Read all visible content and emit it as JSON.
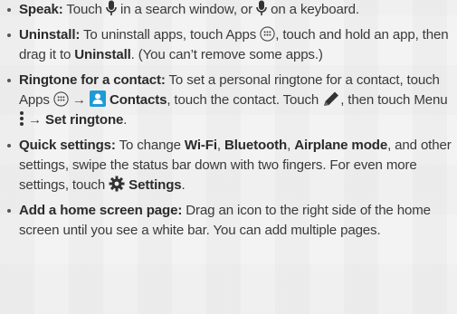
{
  "tips": [
    {
      "title": "Speak:",
      "text_1": " Touch ",
      "text_2": " in a search window, or ",
      "text_3": " on a keyboard."
    },
    {
      "title": "Uninstall:",
      "text_1": " To uninstall apps, touch Apps ",
      "text_2": ", touch and hold an app, then drag it to ",
      "bold_1": "Uninstall",
      "text_3": ". (You can’t remove some apps.)"
    },
    {
      "title": "Ringtone for a contact:",
      "text_1": " To set a personal ringtone for a contact, touch Apps ",
      "arrow_1": " → ",
      "bold_1": "Contacts",
      "text_2": ", touch the contact. Touch ",
      "text_3": ", then touch Menu ",
      "arrow_2": " → ",
      "bold_2": "Set ringtone",
      "text_4": "."
    },
    {
      "title": "Quick settings:",
      "text_1": " To change ",
      "bold_1": "Wi-Fi",
      "text_2": ", ",
      "bold_2": "Bluetooth",
      "text_3": ", ",
      "bold_3": "Airplane mode",
      "text_4": ", and other settings, swipe the status bar down with two fingers. For even more settings, touch ",
      "bold_4": "Settings",
      "text_5": "."
    },
    {
      "title": "Add a home screen page:",
      "text_1": " Drag an icon to the right side of the home screen until you see a white bar. You can add multiple pages."
    }
  ],
  "icons": {
    "mic": "microphone-icon",
    "apps": "apps-grid-icon",
    "contacts": "contacts-icon",
    "edit": "pencil-icon",
    "menu": "menu-dots-icon",
    "settings": "gear-icon"
  },
  "colors": {
    "contacts_accent": "#1e9bd7",
    "text": "#3a3a3a"
  }
}
